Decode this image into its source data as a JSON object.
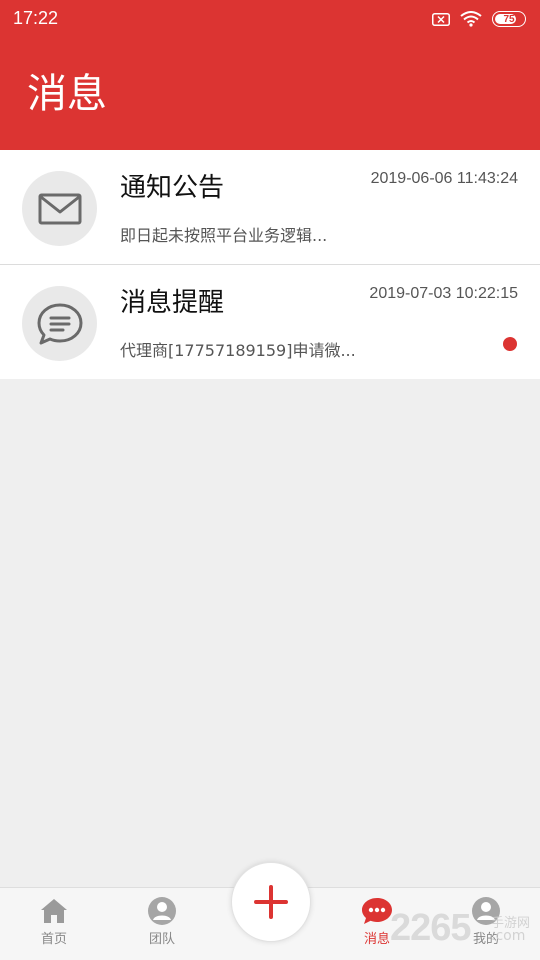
{
  "status_bar": {
    "time": "17:22",
    "battery": "75",
    "battery_fraction": 0.75
  },
  "header": {
    "title": "消息"
  },
  "messages": [
    {
      "title": "通知公告",
      "time": "2019-06-06 11:43:24",
      "preview": "即日起未按照平台业务逻辑...",
      "icon": "envelope-icon",
      "unread": false
    },
    {
      "title": "消息提醒",
      "time": "2019-07-03 10:22:15",
      "preview": "代理商[17757189159]申请微...",
      "icon": "chat-bubble-icon",
      "unread": true
    }
  ],
  "bottom_nav": {
    "items": [
      {
        "label": "首页",
        "icon": "home-icon",
        "active": false
      },
      {
        "label": "团队",
        "icon": "team-icon",
        "active": false
      },
      {
        "label": "消息",
        "icon": "message-icon",
        "active": true
      },
      {
        "label": "我的",
        "icon": "profile-icon",
        "active": false
      }
    ],
    "fab_icon": "plus-icon"
  },
  "watermark": {
    "number": "2265",
    "line1": "手游网",
    "line2": ".com"
  },
  "colors": {
    "accent": "#dc3432",
    "background": "#efefef"
  }
}
